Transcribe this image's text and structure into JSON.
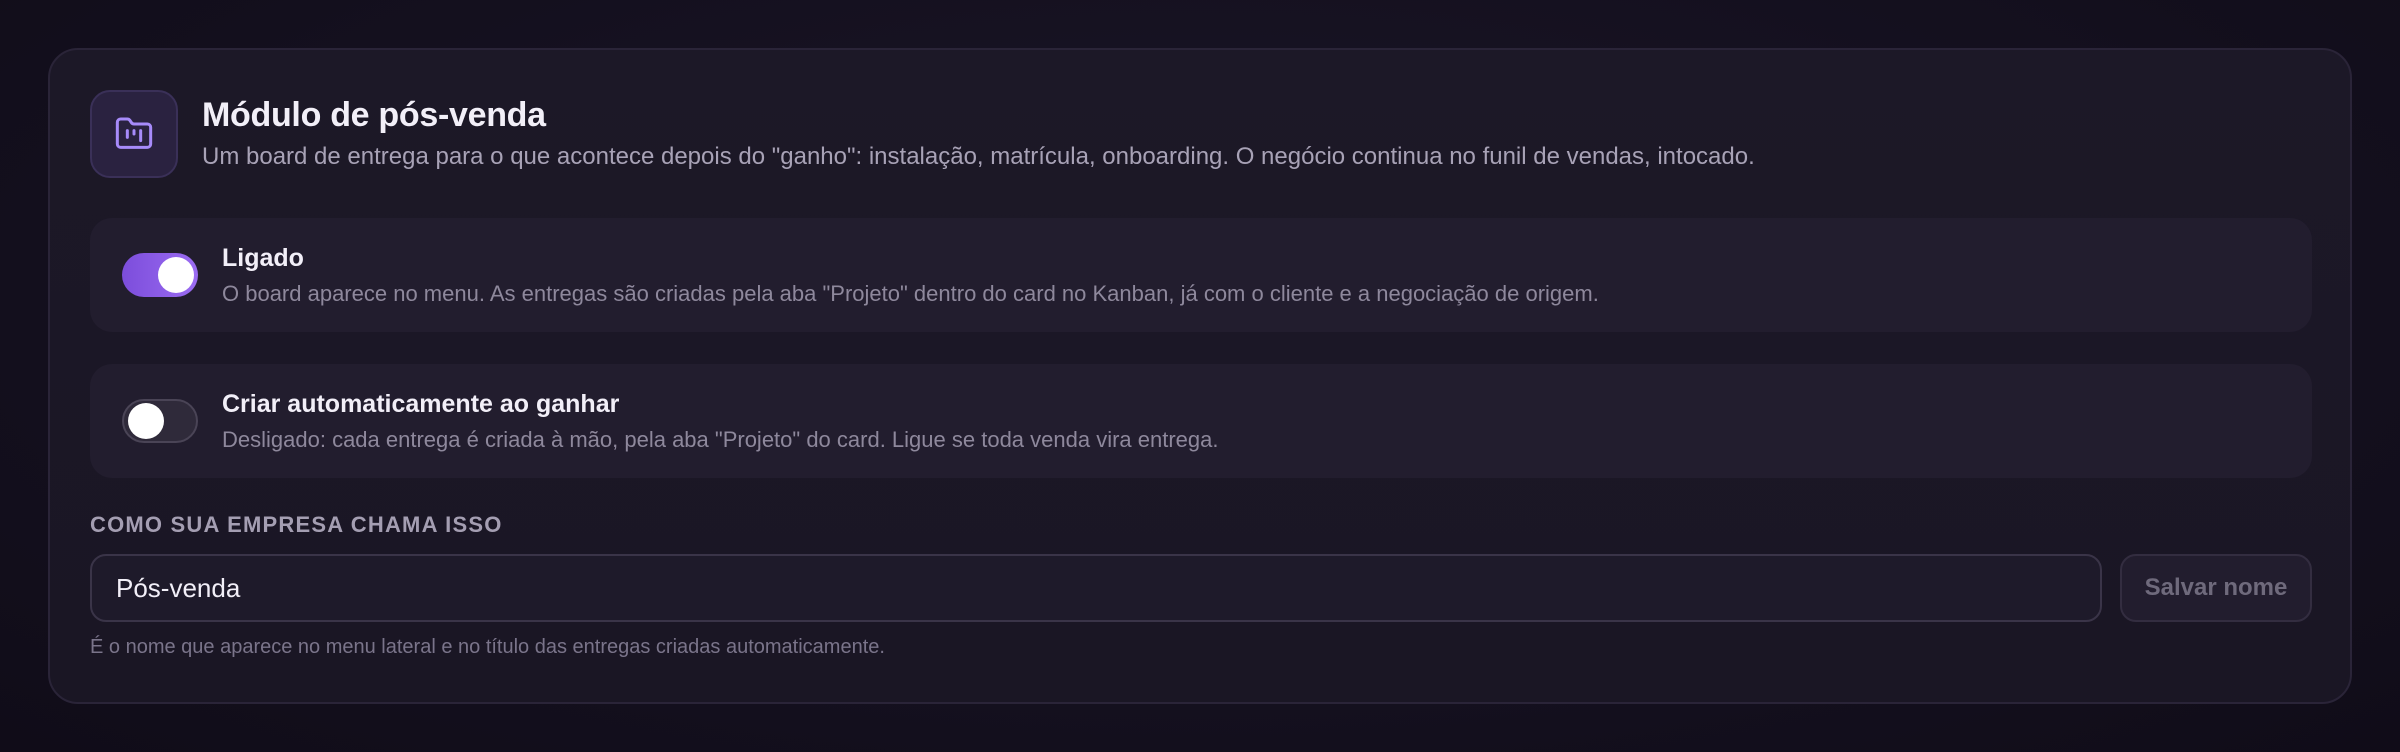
{
  "module": {
    "title": "Módulo de pós-venda",
    "subtitle": "Um board de entrega para o que acontece depois do \"ganho\": instalação, matrícula, onboarding. O negócio continua no funil de vendas, intocado.",
    "icon": "folder-kanban-icon"
  },
  "toggles": {
    "enabled": {
      "title": "Ligado",
      "description": "O board aparece no menu. As entregas são criadas pela aba \"Projeto\" dentro do card no Kanban, já com o cliente e a negociação de origem.",
      "state": "on"
    },
    "auto_create": {
      "title": "Criar automaticamente ao ganhar",
      "description": "Desligado: cada entrega é criada à mão, pela aba \"Projeto\" do card. Ligue se toda venda vira entrega.",
      "state": "off"
    }
  },
  "naming": {
    "label": "COMO SUA EMPRESA CHAMA ISSO",
    "value": "Pós-venda",
    "save_label": "Salvar nome",
    "helper": "É o nome que aparece no menu lateral e no título das entregas criadas automaticamente."
  },
  "colors": {
    "accent": "#8b5cf6",
    "background": "#140f1f"
  }
}
